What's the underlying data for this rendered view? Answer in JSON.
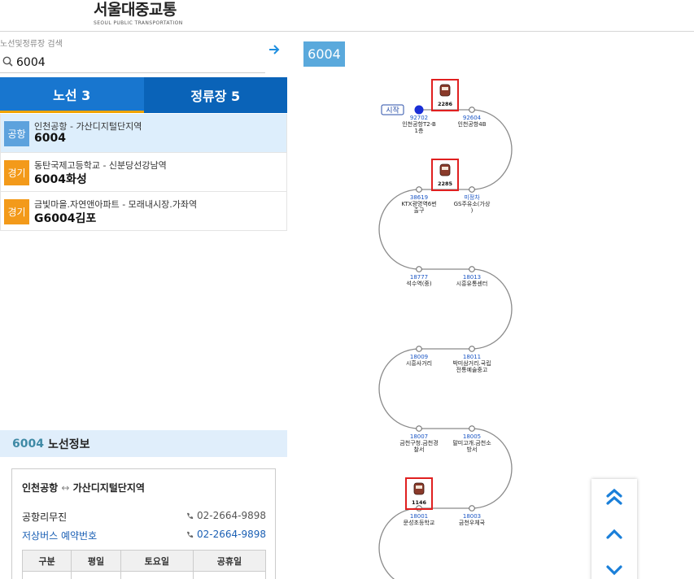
{
  "header": {
    "logo_ko": "서울대중교통",
    "logo_en": "SEOUL PUBLIC TRANSPORTATION"
  },
  "search": {
    "label": "노선및정류장 검색",
    "value": "6004",
    "go_icon": "arrow-right-icon"
  },
  "tabs": [
    {
      "label": "노선 3",
      "active": true
    },
    {
      "label": "정류장 5",
      "active": false
    }
  ],
  "results": [
    {
      "badge": "공항",
      "route": "인천공항 - 가산디지털단지역",
      "number": "6004",
      "type": "airport",
      "selected": true
    },
    {
      "badge": "경기",
      "route": "동탄국제고등학교 - 신분당선강남역",
      "number": "6004화성",
      "type": "gg",
      "selected": false
    },
    {
      "badge": "경기",
      "route": "금빛마을.자연앤아파트 - 모래내시장.가좌역",
      "number": "G6004김포",
      "type": "gg",
      "selected": false
    }
  ],
  "route_info": {
    "number": "6004",
    "heading": "노선정보",
    "title_from": "인천공항",
    "title_arrow": "↔",
    "title_to": "가산디지털단지역",
    "company": {
      "label": "공항리무진",
      "tel": "02-2664-9898"
    },
    "reservation": {
      "label": "저상버스 예약번호",
      "tel": "02-2664-9898"
    },
    "table_headers": [
      "구분",
      "평일",
      "토요일",
      "공휴일"
    ]
  },
  "route_map": {
    "tag": "6004",
    "start_label": "시작",
    "stops": [
      {
        "id": "92702",
        "name": "인천공항T2-B\n1층"
      },
      {
        "id": "92604",
        "name": "인천공항4B"
      },
      {
        "id": "38619",
        "name": "KTX광명역6번\n출구"
      },
      {
        "id": "미정차",
        "name": "GS주유소(가상\n)"
      },
      {
        "id": "18777",
        "name": "석수역(중)"
      },
      {
        "id": "18013",
        "name": "시흥유통센터"
      },
      {
        "id": "18009",
        "name": "시흥사거리"
      },
      {
        "id": "18011",
        "name": "박미삼거리.국립\n전통예술중고"
      },
      {
        "id": "18007",
        "name": "금천구청.금천경\n찰서"
      },
      {
        "id": "18005",
        "name": "말미고개.금천소\n방서"
      },
      {
        "id": "18001",
        "name": "문성초등학교"
      },
      {
        "id": "18003",
        "name": "금천우체국"
      }
    ],
    "buses": [
      {
        "plate": "2286",
        "segment": 0
      },
      {
        "plate": "2285",
        "segment": 1
      },
      {
        "plate": "1146",
        "segment": 5
      }
    ],
    "colors": {
      "line": "#8a8a8a",
      "stop_id": "#1a55c4",
      "bus_box": "#e02020",
      "start_dot": "#1a2fd6"
    }
  },
  "scroll_controls": [
    "double-chevron-up-icon",
    "chevron-up-icon",
    "chevron-down-icon"
  ]
}
